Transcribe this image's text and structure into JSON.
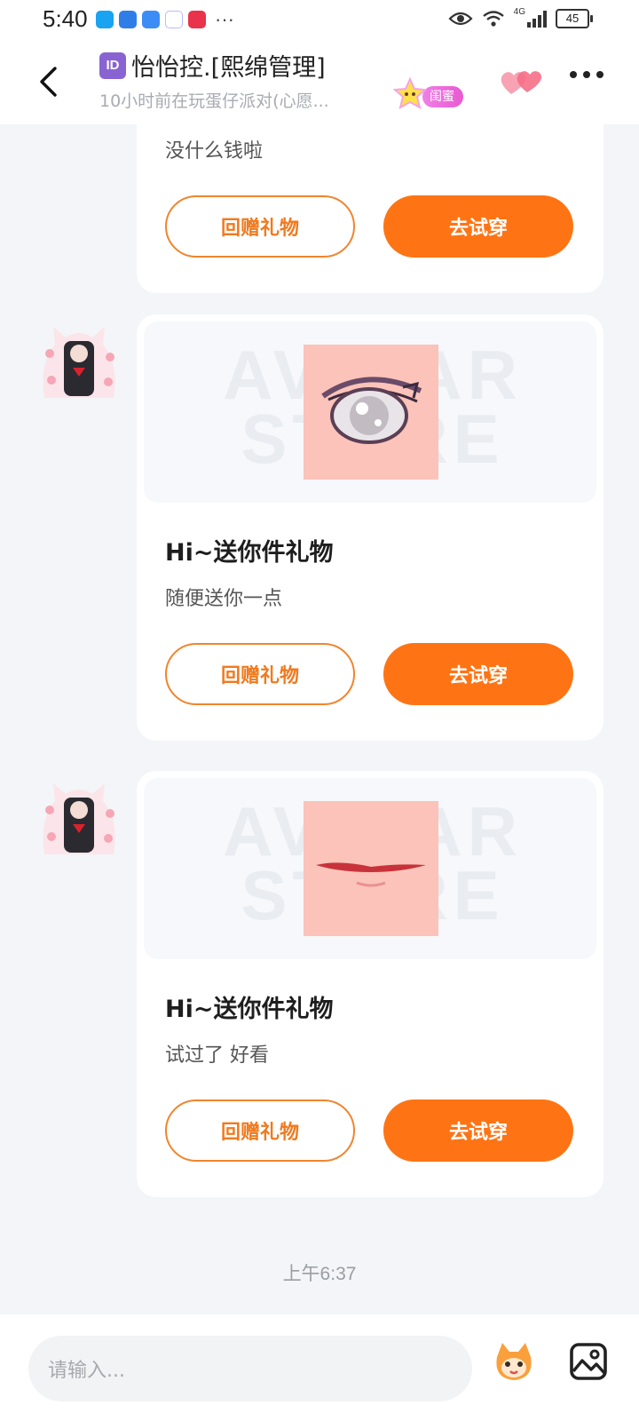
{
  "status_bar": {
    "time": "5:40",
    "network": "4G",
    "battery": "45",
    "more": "···"
  },
  "header": {
    "title": "怡怡控.[熙绵管理]",
    "subtitle": "10小时前在玩蛋仔派对(心愿...",
    "bestie_badge": "闺蜜",
    "id_badge": "ID"
  },
  "messages": [
    {
      "title": "",
      "text": "没什么钱啦",
      "return_gift_label": "回赠礼物",
      "try_on_label": "去试穿"
    },
    {
      "title": "Hi~送你件礼物",
      "text": "随便送你一点",
      "return_gift_label": "回赠礼物",
      "try_on_label": "去试穿",
      "watermark": "AVATAR STORE",
      "item_icon": "eye-item-icon"
    },
    {
      "title": "Hi~送你件礼物",
      "text": "试过了 好看",
      "return_gift_label": "回赠礼物",
      "try_on_label": "去试穿",
      "watermark": "AVATAR STORE",
      "item_icon": "mouth-item-icon"
    }
  ],
  "timestamp": "上午6:37",
  "input": {
    "placeholder": "请输入..."
  },
  "colors": {
    "accent": "#fe7414",
    "accent_outline": "#f0852d",
    "background": "#f3f5f8"
  }
}
